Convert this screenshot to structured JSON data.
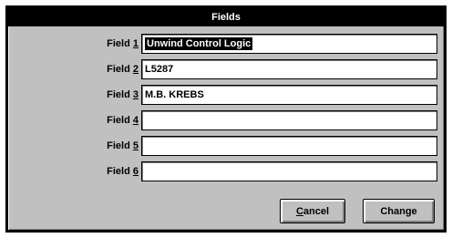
{
  "dialog": {
    "title": "Fields",
    "fields": [
      {
        "label": "Field ",
        "mnemonic": "1",
        "value": "Unwind Control Logic",
        "selected": true
      },
      {
        "label": "Field ",
        "mnemonic": "2",
        "value": "L5287",
        "selected": false
      },
      {
        "label": "Field ",
        "mnemonic": "3",
        "value": "M.B. KREBS",
        "selected": false
      },
      {
        "label": "Field ",
        "mnemonic": "4",
        "value": "",
        "selected": false
      },
      {
        "label": "Field ",
        "mnemonic": "5",
        "value": "",
        "selected": false
      },
      {
        "label": "Field ",
        "mnemonic": "6",
        "value": "",
        "selected": false
      }
    ],
    "cancel": {
      "mnemonic": "C",
      "rest": "ancel"
    },
    "change": {
      "label": "Change"
    }
  }
}
